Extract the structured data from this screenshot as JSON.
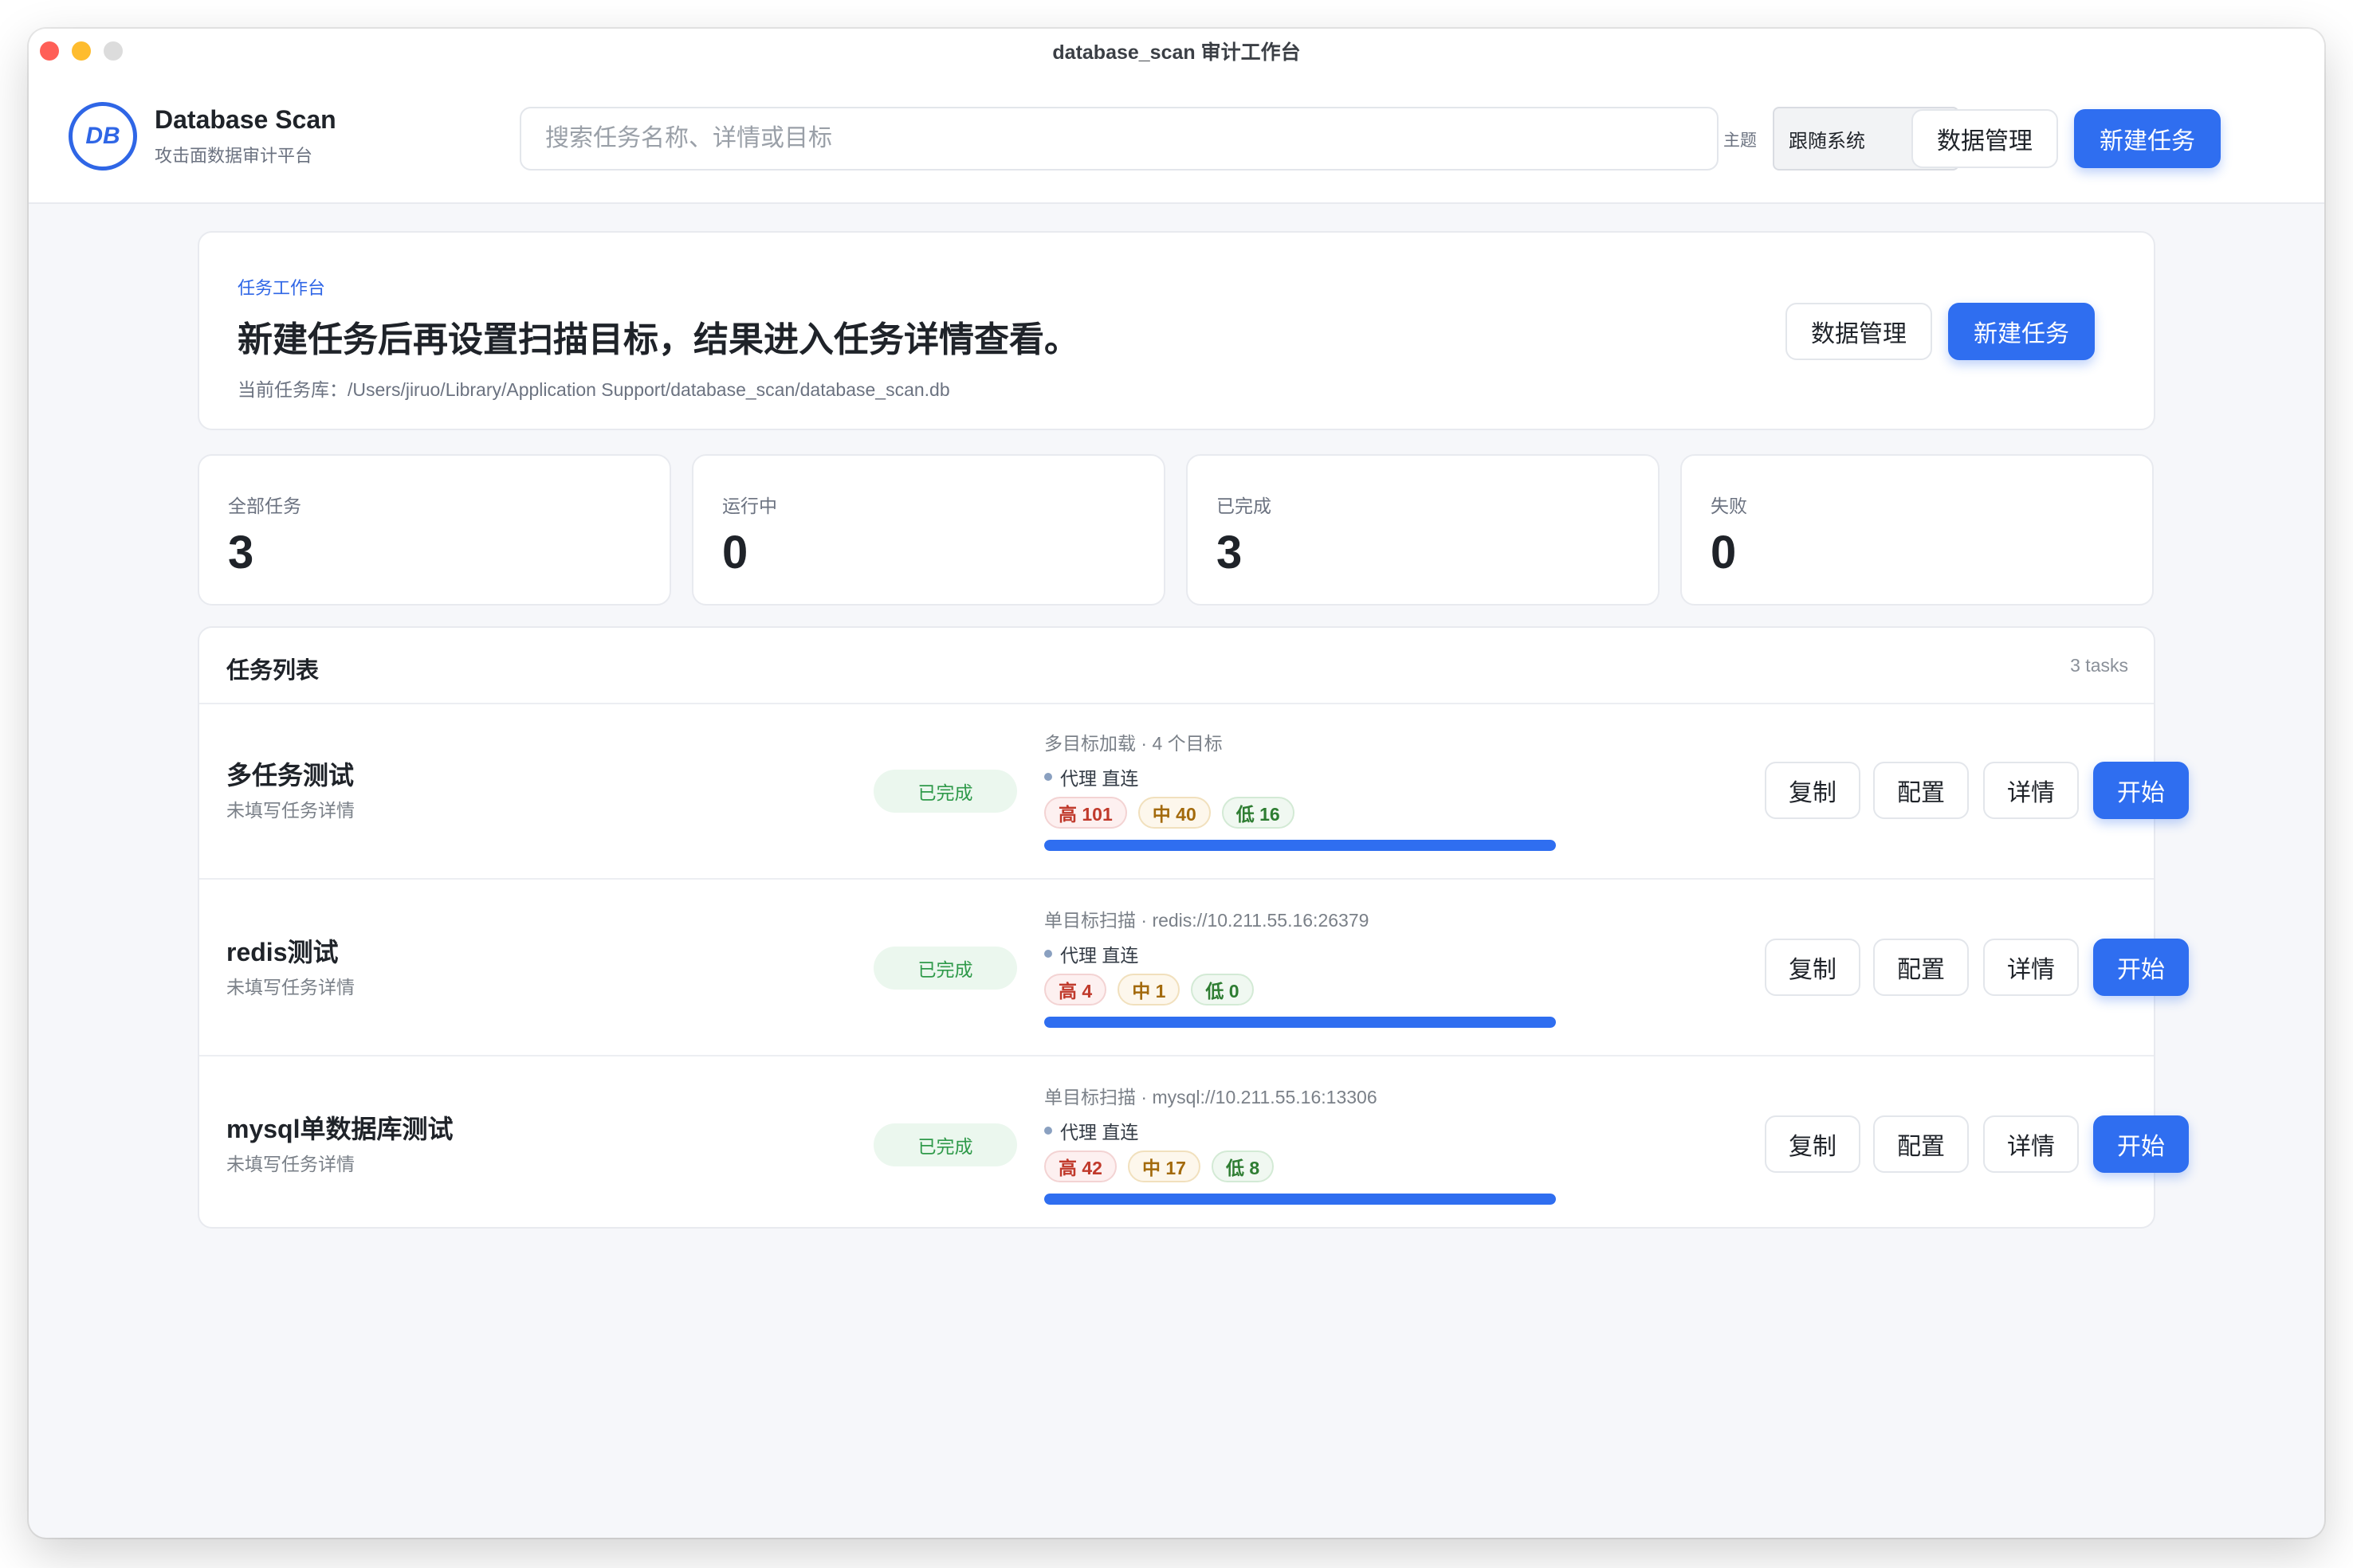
{
  "window": {
    "title": "database_scan 审计工作台"
  },
  "brand": {
    "logo_text": "DB",
    "name": "Database Scan",
    "subtitle": "攻击面数据审计平台"
  },
  "header": {
    "search_placeholder": "搜索任务名称、详情或目标",
    "theme_label": "主题",
    "theme_value": "跟随系统",
    "data_manage_label": "数据管理",
    "new_task_label": "新建任务"
  },
  "hero": {
    "eyebrow": "任务工作台",
    "title": "新建任务后再设置扫描目标，结果进入任务详情查看。",
    "db_path": "当前任务库：/Users/jiruo/Library/Application Support/database_scan/database_scan.db",
    "data_manage_label": "数据管理",
    "new_task_label": "新建任务"
  },
  "stats": [
    {
      "label": "全部任务",
      "value": "3"
    },
    {
      "label": "运行中",
      "value": "0"
    },
    {
      "label": "已完成",
      "value": "3"
    },
    {
      "label": "失败",
      "value": "0"
    }
  ],
  "task_list": {
    "title": "任务列表",
    "count": "3 tasks",
    "actions": {
      "copy": "复制",
      "config": "配置",
      "detail": "详情",
      "start": "开始"
    },
    "tasks": [
      {
        "name": "多任务测试",
        "desc": "未填写任务详情",
        "status": "已完成",
        "meta": "多目标加载 · 4 个目标",
        "proxy": "代理 直连",
        "high": "高 101",
        "mid": "中 40",
        "low": "低 16",
        "progress": 1.0
      },
      {
        "name": "redis测试",
        "desc": "未填写任务详情",
        "status": "已完成",
        "meta": "单目标扫描 · redis://10.211.55.16:26379",
        "proxy": "代理 直连",
        "high": "高 4",
        "mid": "中 1",
        "low": "低 0",
        "progress": 1.0
      },
      {
        "name": "mysql单数据库测试",
        "desc": "未填写任务详情",
        "status": "已完成",
        "meta": "单目标扫描 · mysql://10.211.55.16:13306",
        "proxy": "代理 直连",
        "high": "高 42",
        "mid": "中 17",
        "low": "低 8",
        "progress": 1.0
      }
    ]
  },
  "colors": {
    "accent": "#2f6ef0",
    "success": "#2f9a4a",
    "high": "#c0392b",
    "mid": "#a36a0c",
    "low": "#2e7d32"
  }
}
